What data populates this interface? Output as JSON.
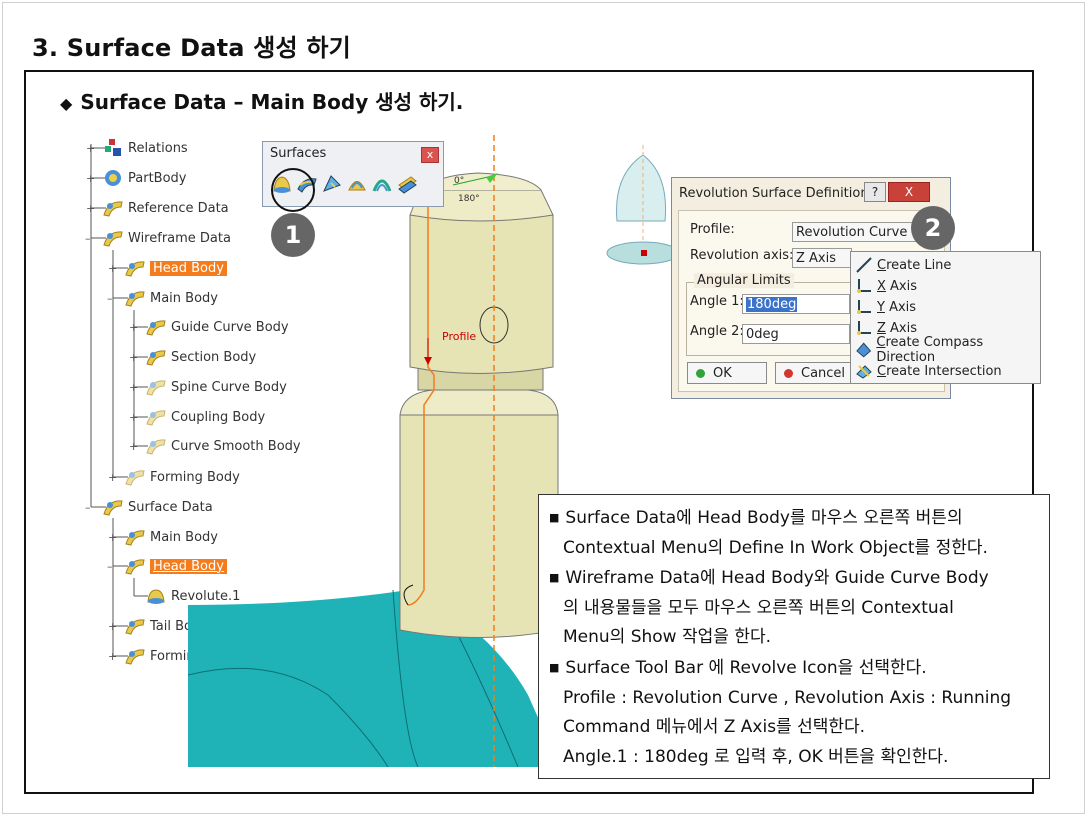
{
  "slide": {
    "title": "3. Surface Data 생성 하기",
    "subtitle": "Surface Data – Main Body 생성 하기.",
    "subtitle_bullet": "◆"
  },
  "tree": {
    "items": [
      {
        "label": "Relations",
        "icon": "relations-icon"
      },
      {
        "label": "PartBody",
        "icon": "partbody-icon"
      },
      {
        "label": "Reference Data",
        "icon": "geometrical-set-icon"
      },
      {
        "label": "Wireframe Data",
        "icon": "geometrical-set-icon"
      },
      {
        "label": "Head Body",
        "icon": "geometrical-set-icon",
        "highlight": true
      },
      {
        "label": "Main Body",
        "icon": "geometrical-set-icon"
      },
      {
        "label": "Guide Curve Body",
        "icon": "geometrical-set-icon"
      },
      {
        "label": "Section Body",
        "icon": "geometrical-set-icon"
      },
      {
        "label": "Spine Curve Body",
        "icon": "geometrical-set-hidden-icon"
      },
      {
        "label": "Coupling Body",
        "icon": "geometrical-set-hidden-icon"
      },
      {
        "label": "Curve Smooth Body",
        "icon": "geometrical-set-hidden-icon"
      },
      {
        "label": "Forming Body",
        "icon": "geometrical-set-hidden-icon"
      },
      {
        "label": "Surface Data",
        "icon": "geometrical-set-icon"
      },
      {
        "label": "Main Body",
        "icon": "geometrical-set-icon"
      },
      {
        "label": "Head Body",
        "icon": "geometrical-set-icon",
        "highlight": true
      },
      {
        "label": "Revolute.1",
        "icon": "revolve-surface-icon"
      },
      {
        "label": "Tail Body",
        "icon": "geometrical-set-icon"
      },
      {
        "label": "Forming Body",
        "icon": "geometrical-set-icon"
      }
    ]
  },
  "viewport": {
    "profile_label": "Profile",
    "compass_labels": [
      "0°",
      "180°"
    ]
  },
  "surfaces_toolbar": {
    "title": "Surfaces",
    "close": "x",
    "icons": [
      "revolve-icon",
      "sweep-icon",
      "fill-icon",
      "multi-section-icon",
      "blend-icon",
      "offset-icon"
    ]
  },
  "callouts": {
    "one": "1",
    "two": "2"
  },
  "dialog": {
    "title": "Revolution Surface Definition",
    "help": "?",
    "close": "X",
    "profile_label": "Profile:",
    "profile_value": "Revolution Curve",
    "axis_label": "Revolution axis:",
    "axis_value": "Z Axis",
    "group_label": "Angular Limits",
    "angle1_label": "Angle 1:",
    "angle1_value": "180deg",
    "angle2_label": "Angle 2:",
    "angle2_value": "0deg",
    "ok_label": "OK",
    "cancel_label": "Cancel"
  },
  "context_menu": {
    "items": [
      {
        "first": "C",
        "rest": "reate Line",
        "icon": "line-icon"
      },
      {
        "first": "X",
        "rest": " Axis",
        "icon": "axis-x-icon"
      },
      {
        "first": "Y",
        "rest": " Axis",
        "icon": "axis-y-icon"
      },
      {
        "first": "Z",
        "rest": " Axis",
        "icon": "axis-z-icon"
      },
      {
        "first": "C",
        "rest": "reate Compass Direction",
        "icon": "compass-icon"
      },
      {
        "first": "C",
        "rest": "reate Intersection",
        "icon": "intersection-icon"
      }
    ]
  },
  "notes": {
    "bullet": "■",
    "lines": [
      {
        "text": "Surface Data에 Head Body를 마우스 오른쪽 버튼의",
        "bullet": true
      },
      {
        "text": "Contextual Menu의 Define In Work Object를 정한다.",
        "bullet": false
      },
      {
        "text": "Wireframe Data에 Head Body와 Guide Curve Body",
        "bullet": true
      },
      {
        "text": "의 내용물들을 모두 마우스 오른쪽 버튼의 Contextual",
        "bullet": false
      },
      {
        "text": "Menu의 Show 작업을 한다.",
        "bullet": false
      },
      {
        "text": "Surface Tool Bar 에 Revolve Icon을 선택한다.",
        "bullet": true
      },
      {
        "text": "Profile : Revolution Curve , Revolution Axis : Running",
        "bullet": false
      },
      {
        "text": "Command 메뉴에서 Z Axis를 선택한다.",
        "bullet": false
      },
      {
        "text": "Angle.1 : 180deg 로 입력 후, OK 버튼을 확인한다.",
        "bullet": false
      }
    ]
  },
  "colors": {
    "highlight": "#f47c1c",
    "part": "#e6e4b4",
    "surface": "#1fb3b8",
    "axis": "#f47c1c"
  }
}
